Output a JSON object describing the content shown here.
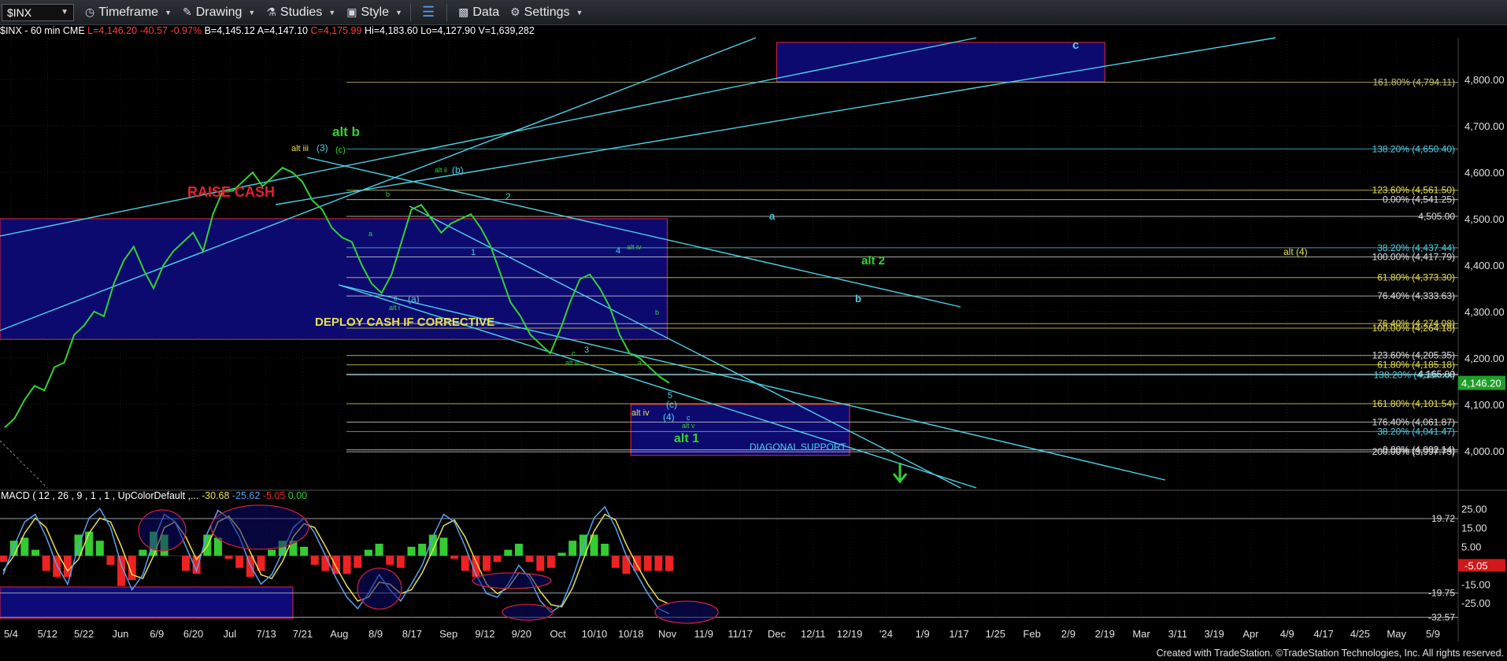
{
  "toolbar": {
    "symbol": "$INX",
    "buttons": [
      {
        "label": "Timeframe",
        "icon": "clock-icon"
      },
      {
        "label": "Drawing",
        "icon": "pencil-icon"
      },
      {
        "label": "Studies",
        "icon": "flask-icon"
      },
      {
        "label": "Style",
        "icon": "style-icon"
      },
      {
        "label": "",
        "icon": "layout-icon"
      },
      {
        "label": "Data",
        "icon": "bar-chart-icon"
      },
      {
        "label": "Settings",
        "icon": "gear-icon"
      }
    ]
  },
  "info": {
    "symbol_line": "$INX - 60 min  CME",
    "last": "L=4,146.20",
    "change": "-40.57",
    "change_pct": "-0.97%",
    "bid": "B=4,145.12",
    "ask": "A=4,147.10",
    "close": "C=4,175.99",
    "high": "Hi=4,183.60",
    "low": "Lo=4,127.90",
    "volume": "V=1,639,282"
  },
  "macd_label": {
    "prefix": "MACD ( 12 , 26 , 9 , 1 , 1 , UpColorDefault ,...",
    "v1": "-30.68",
    "v2": "-25.62",
    "v3": "-5.05",
    "v4": "0.00"
  },
  "footer": "Created with TradeStation. ©TradeStation Technologies, Inc. All rights reserved.",
  "colors": {
    "fib": "#d8d48a",
    "trendline": "#4fd0e6",
    "box_fill": "#0d0b78",
    "box_border": "#c8203a",
    "price": "#33d133",
    "macd_line": "#5aa0f0",
    "signal_line": "#e8e050",
    "hist_up": "#33cc33",
    "hist_down": "#ee2222"
  },
  "chart_data": {
    "type": "line",
    "title": "",
    "xlabel": "",
    "ylabel": "",
    "ylim": [
      3920,
      4890
    ],
    "x_tick_labels": [
      "5/4",
      "5/12",
      "5/22",
      "Jun",
      "6/9",
      "6/20",
      "Jul",
      "7/13",
      "7/21",
      "Aug",
      "8/9",
      "8/17",
      "Sep",
      "9/12",
      "9/20",
      "Oct",
      "10/10",
      "10/18",
      "Nov",
      "11/9",
      "11/17",
      "Dec",
      "12/11",
      "12/19",
      "'24",
      "1/9",
      "1/17",
      "1/25",
      "Feb",
      "2/9",
      "2/19",
      "Mar",
      "3/11",
      "3/19",
      "Apr",
      "4/9",
      "4/17",
      "4/25",
      "May",
      "5/9"
    ],
    "y_ticks": [
      4000,
      4100,
      4200,
      4300,
      4400,
      4500,
      4600,
      4700,
      4800
    ],
    "y_tick_labels": [
      "4,000.00",
      "4,100.00",
      "4,200.00",
      "4,300.00",
      "4,400.00",
      "4,500.00",
      "4,600.00",
      "4,700.00",
      "4,800.00"
    ],
    "last_price": 4146.2,
    "last_price_label": "4,146.20",
    "series": [
      {
        "values": [
          4050,
          4070,
          4110,
          4140,
          4130,
          4180,
          4190,
          4250,
          4270,
          4300,
          4290,
          4360,
          4410,
          4440,
          4390,
          4350,
          4400,
          4430,
          4450,
          4470,
          4430,
          4510,
          4560,
          4560,
          4580,
          4600,
          4570,
          4590,
          4610,
          4600,
          4580,
          4540,
          4520,
          4480,
          4460,
          4450,
          4400,
          4360,
          4340,
          4380,
          4450,
          4520,
          4530,
          4500,
          4470,
          4490,
          4500,
          4510,
          4480,
          4440,
          4380,
          4320,
          4290,
          4250,
          4230,
          4210,
          4260,
          4320,
          4370,
          4380,
          4350,
          4310,
          4250,
          4210,
          4200,
          4180,
          4160,
          4146.2
        ]
      }
    ],
    "fib_levels": [
      {
        "label": "161.80% (4,794.11)",
        "value": 4794.11,
        "color": "#c8c47a"
      },
      {
        "label": "138.20% (4,650.40)",
        "value": 4650.4,
        "color": "#4fd0e6"
      },
      {
        "label": "123.60% (4,561.50)",
        "value": 4561.5,
        "color": "#e8e050"
      },
      {
        "label": "0.00% (4,541.25)",
        "value": 4541.25,
        "color": "#e0e0e0"
      },
      {
        "label": "4,505.00",
        "value": 4505.0,
        "color": "#e0e0e0"
      },
      {
        "label": "38.20% (4,437.44)",
        "value": 4437.44,
        "color": "#4fd0e6"
      },
      {
        "label": "100.00% (4,417.79)",
        "value": 4417.79,
        "color": "#e0e0e0"
      },
      {
        "label": "61.80% (4,373.30)",
        "value": 4373.3,
        "color": "#e8e050"
      },
      {
        "label": "76.40% (4,333.63)",
        "value": 4333.63,
        "color": "#e0e0e0"
      },
      {
        "label": "76.40% (4,274.08)",
        "value": 4274.08,
        "color": "#e8e050"
      },
      {
        "label": "100.00% (4,264.18)",
        "value": 4264.18,
        "color": "#e8e050"
      },
      {
        "label": "123.60% (4,205.35)",
        "value": 4205.35,
        "color": "#e0e0e0"
      },
      {
        "label": "61.80% (4,185.18)",
        "value": 4185.18,
        "color": "#e8e050"
      },
      {
        "label": "138.20% (4,16x.xx)",
        "value": 4163.0,
        "color": "#4fd0e6"
      },
      {
        "label": "4,165.00",
        "value": 4165.0,
        "color": "#e0e0e0"
      },
      {
        "label": "161.80% (4,101.54)",
        "value": 4101.54,
        "color": "#e8e050"
      },
      {
        "label": "176.40% (4,061.87)",
        "value": 4061.87,
        "color": "#e0e0e0"
      },
      {
        "label": "38.20% (4,041.47)",
        "value": 4041.47,
        "color": "#4fd0e6"
      },
      {
        "label": "0.00% (4,002.14)",
        "value": 4002.14,
        "color": "#e0e0e0"
      },
      {
        "label": "200.00% (3,997.73)",
        "value": 3997.73,
        "color": "#e0e0e0"
      }
    ],
    "zones": [
      {
        "label": "DEPLOY CASH IF CORRECTIVE",
        "y_top": 4500,
        "y_bottom": 4240,
        "x_start": "5/4",
        "x_end": "Nov"
      },
      {
        "label": "DIAGONAL SUPPORT",
        "y_top": 4100,
        "y_bottom": 3990,
        "x_start": "10/18",
        "x_end": "12/19"
      },
      {
        "label": "c",
        "y_top": 4880,
        "y_bottom": 4795,
        "x_start": "Dec",
        "x_end": "2/19"
      }
    ],
    "annotations": [
      "RAISE CASH",
      "DEPLOY CASH IF CORRECTIVE",
      "alt b",
      "alt iii",
      "(3)",
      "(c)",
      "alt ii",
      "(b)",
      "2",
      "b",
      "a",
      "c",
      "alt i",
      "(a)",
      "1",
      "alt iv",
      "4",
      "3",
      "alt iii",
      "5",
      "(c)",
      "(4)",
      "alt iv",
      "alt v",
      "alt 1",
      "DIAGONAL SUPPORT",
      "alt 2",
      "alt (4)",
      "a",
      "b",
      "c"
    ],
    "macd": {
      "ylim": [
        -37,
        31
      ],
      "y_tick_labels": [
        "25.00",
        "15.00",
        "5.00",
        "-15.00",
        "-25.00"
      ],
      "y_ticks": [
        25,
        15,
        5,
        -15,
        -25
      ],
      "ref_levels": [
        {
          "label": "19.72",
          "value": 19.72
        },
        {
          "label": "-19.75",
          "value": -19.75
        },
        {
          "label": "-32.57",
          "value": -32.57
        }
      ],
      "current_label": "-5.05",
      "current_value": -5.05,
      "macd": [
        -10,
        5,
        18,
        22,
        10,
        -5,
        -15,
        5,
        20,
        25,
        15,
        -5,
        -18,
        -10,
        8,
        22,
        18,
        5,
        -8,
        12,
        24,
        20,
        10,
        -5,
        -15,
        -10,
        2,
        15,
        20,
        12,
        0,
        -12,
        -22,
        -28,
        -20,
        -10,
        -18,
        -24,
        -15,
        -5,
        10,
        22,
        18,
        5,
        -10,
        -20,
        -22,
        -15,
        -5,
        -12,
        -24,
        -30,
        -26,
        -12,
        5,
        20,
        26,
        15,
        0,
        -10,
        -20,
        -28,
        -30.68
      ],
      "signal": [
        -8,
        0,
        12,
        20,
        15,
        2,
        -8,
        -2,
        12,
        20,
        18,
        5,
        -10,
        -12,
        0,
        15,
        18,
        10,
        -2,
        5,
        18,
        21,
        14,
        2,
        -10,
        -12,
        -3,
        10,
        17,
        15,
        5,
        -6,
        -16,
        -24,
        -22,
        -14,
        -15,
        -20,
        -18,
        -9,
        3,
        16,
        19,
        10,
        -3,
        -15,
        -20,
        -17,
        -9,
        -10,
        -19,
        -26,
        -27,
        -17,
        -2,
        13,
        22,
        19,
        6,
        -5,
        -15,
        -23,
        -25.62
      ]
    }
  }
}
